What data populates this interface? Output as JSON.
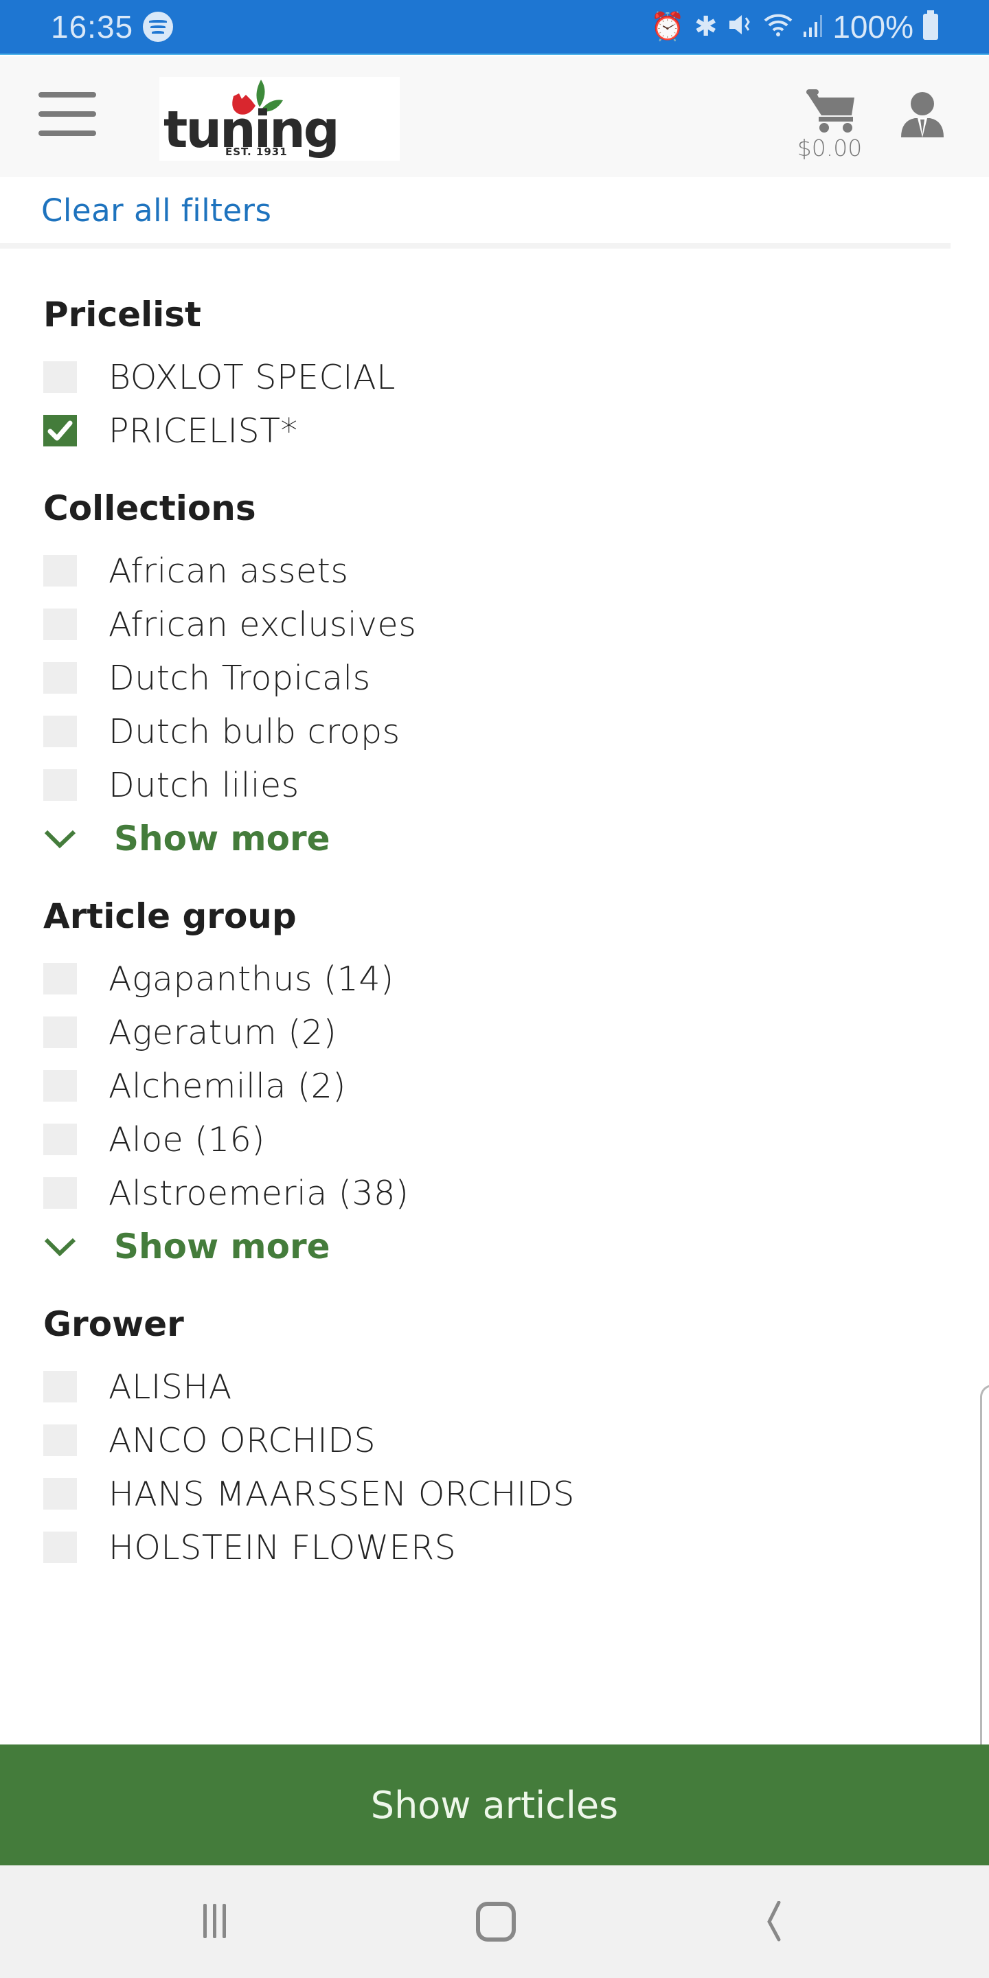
{
  "status_bar": {
    "time": "16:35",
    "notification_icons": [
      "spotify-icon"
    ],
    "system_icons": [
      "alarm-icon",
      "bluetooth-icon",
      "mute-icon",
      "wifi-icon",
      "signal-icon"
    ],
    "battery": "100%"
  },
  "header": {
    "menu_icon": "hamburger-icon",
    "logo_text": "tuning",
    "logo_tagline": "EST. 1931",
    "cart_icon": "cart-icon",
    "cart_total": "$0.00",
    "account_icon": "user-icon"
  },
  "clear_filters": "Clear all filters",
  "filter_groups": [
    {
      "title": "Pricelist",
      "options": [
        {
          "label": "BOXLOT SPECIAL",
          "checked": false
        },
        {
          "label": "PRICELIST*",
          "checked": true
        }
      ]
    },
    {
      "title": "Collections",
      "options": [
        {
          "label": "African assets",
          "checked": false
        },
        {
          "label": "African exclusives",
          "checked": false
        },
        {
          "label": "Dutch Tropicals",
          "checked": false
        },
        {
          "label": "Dutch bulb crops",
          "checked": false
        },
        {
          "label": "Dutch lilies",
          "checked": false
        }
      ],
      "show_more": "Show more"
    },
    {
      "title": "Article group",
      "options": [
        {
          "label": "Agapanthus (14)",
          "checked": false
        },
        {
          "label": "Ageratum (2)",
          "checked": false
        },
        {
          "label": "Alchemilla (2)",
          "checked": false
        },
        {
          "label": "Aloe (16)",
          "checked": false
        },
        {
          "label": "Alstroemeria (38)",
          "checked": false
        }
      ],
      "show_more": "Show more"
    },
    {
      "title": "Grower",
      "options": [
        {
          "label": "ALISHA",
          "checked": false
        },
        {
          "label": "ANCO ORCHIDS",
          "checked": false
        },
        {
          "label": "HANS MAARSSEN ORCHIDS",
          "checked": false
        },
        {
          "label": "HOLSTEIN FLOWERS",
          "checked": false
        }
      ]
    }
  ],
  "show_articles": "Show articles",
  "nav_bar": {
    "buttons": [
      "recent-apps-icon",
      "home-icon",
      "back-icon"
    ]
  },
  "colors": {
    "status_bar": "#1e76d2",
    "accent_green": "#447c3b",
    "link_blue": "#1e73be",
    "checkbox_empty": "#eeeeee"
  }
}
